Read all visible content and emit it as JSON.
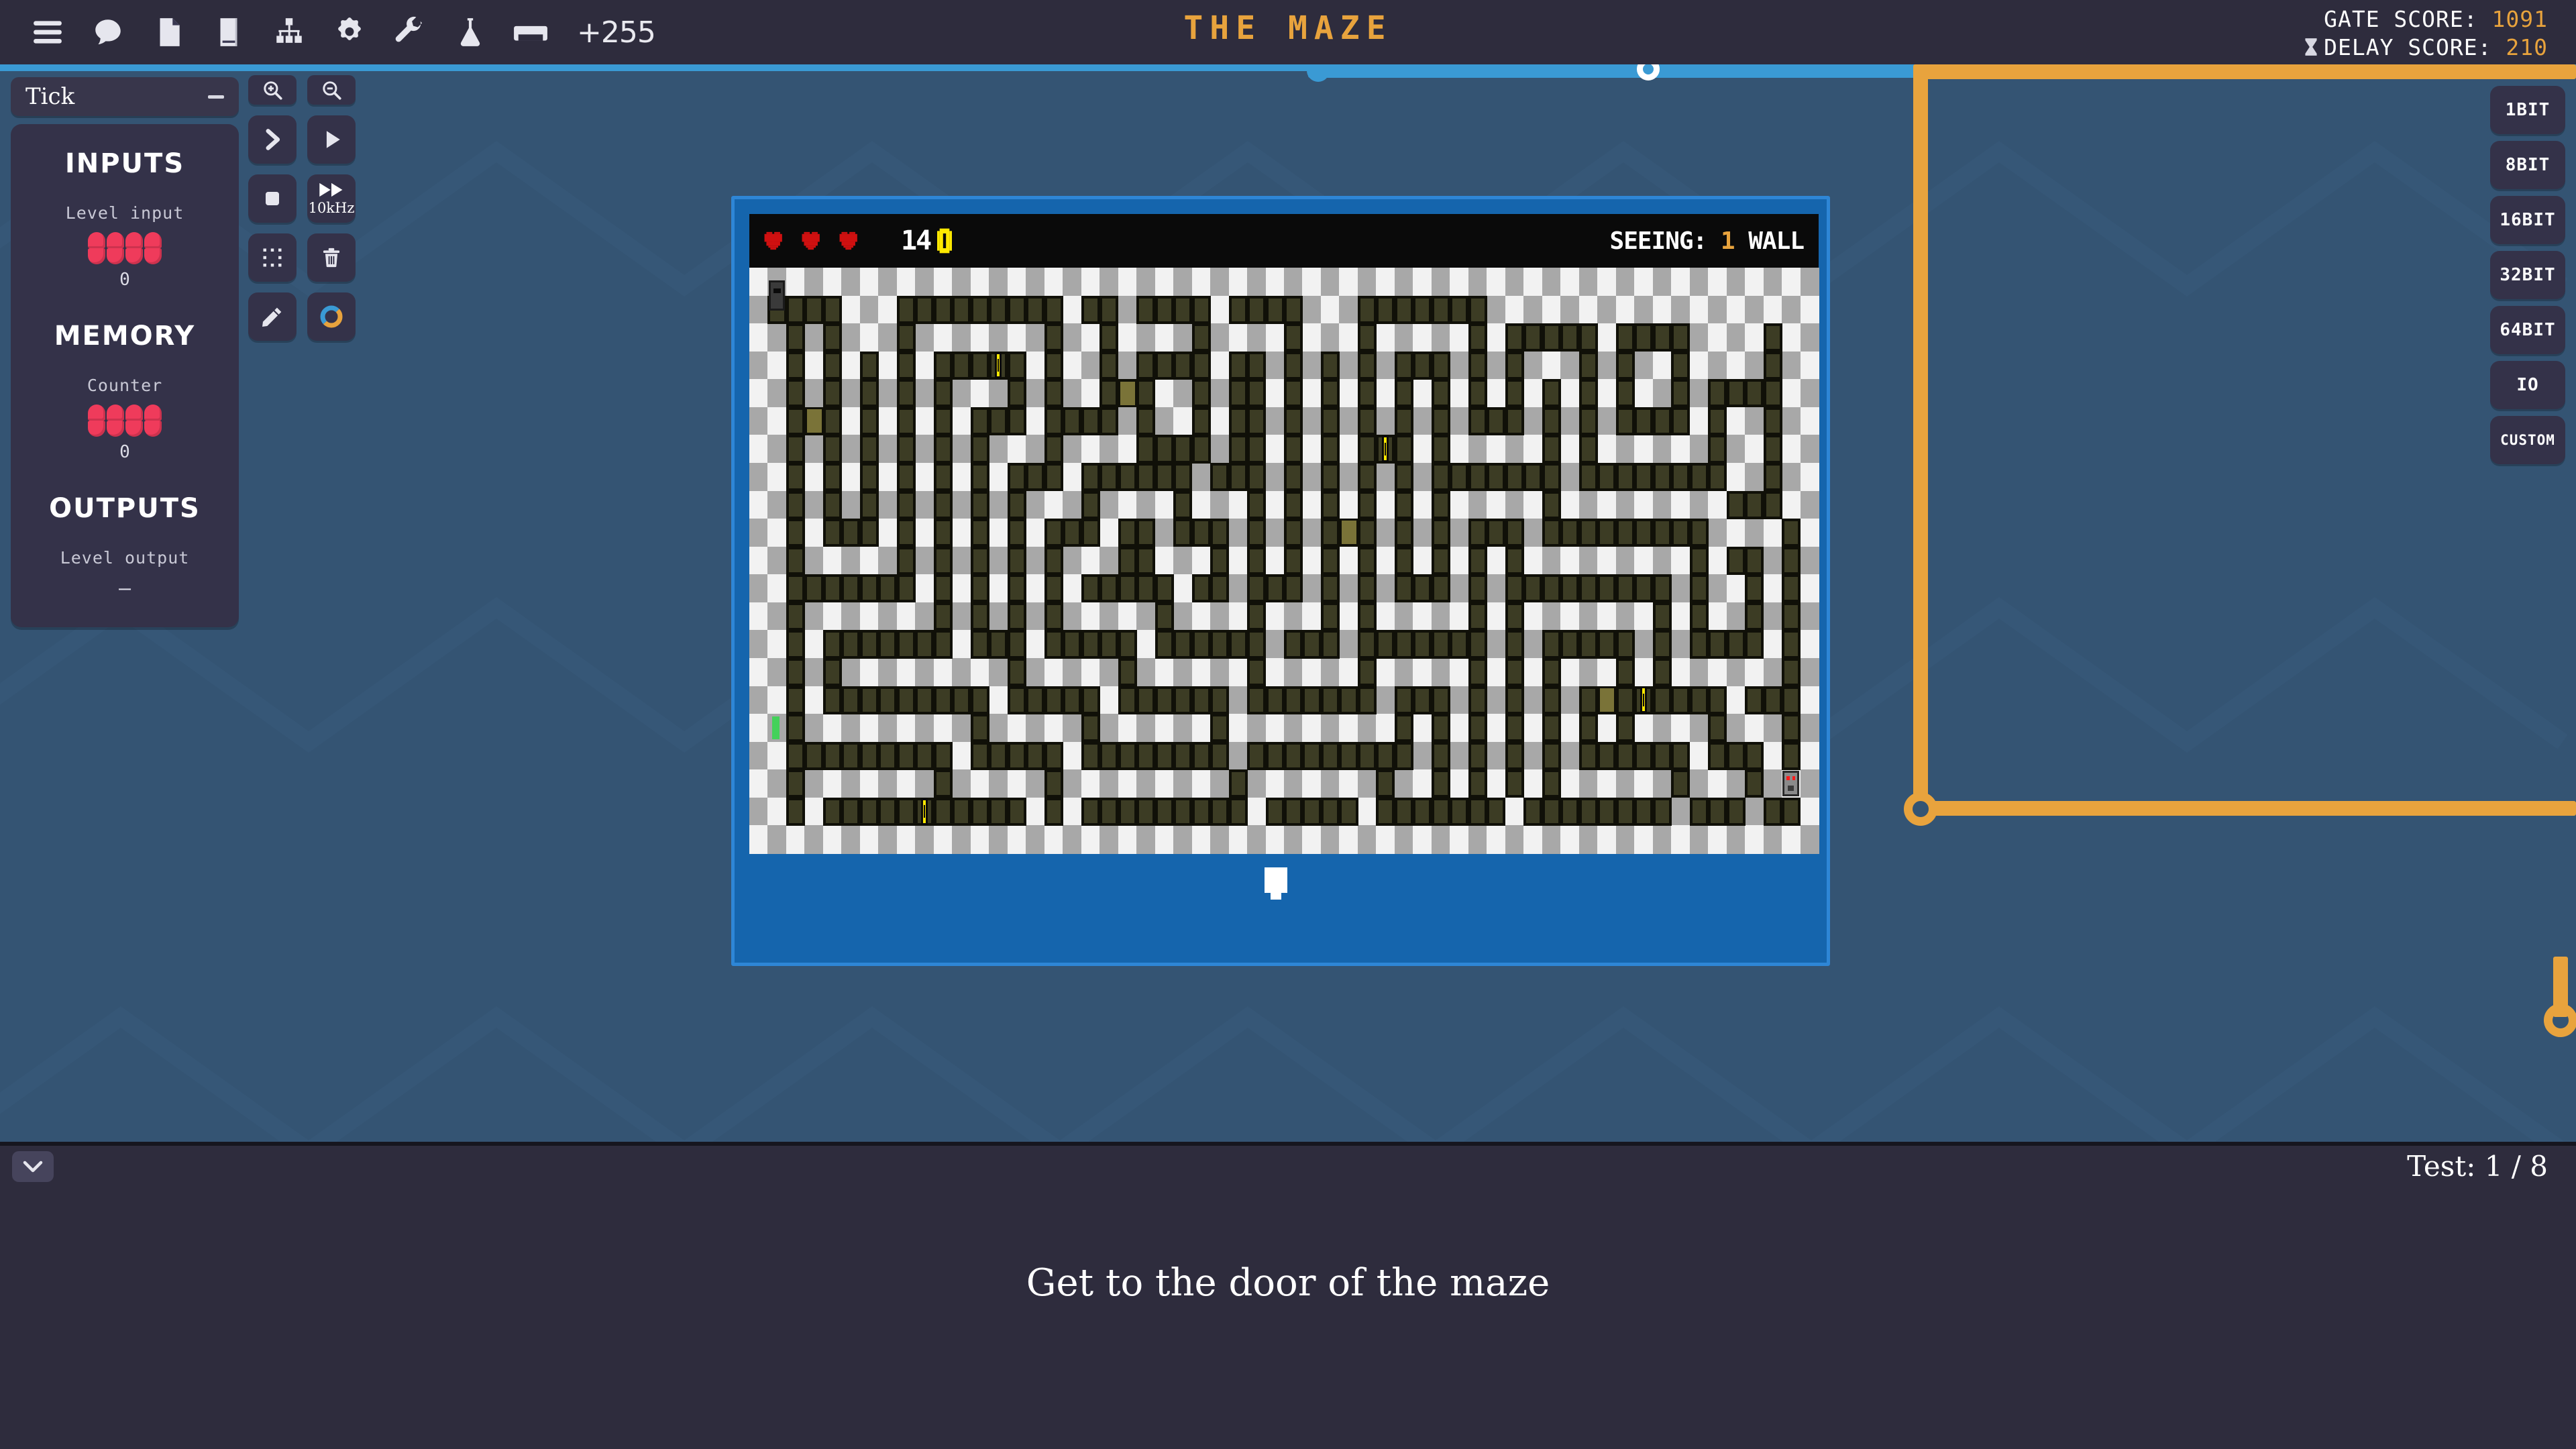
{
  "topbar": {
    "icons": [
      {
        "name": "menu-icon",
        "label": "Menu"
      },
      {
        "name": "chat-icon",
        "label": "Chat"
      },
      {
        "name": "file-icon",
        "label": "File"
      },
      {
        "name": "book-icon",
        "label": "Book"
      },
      {
        "name": "hierarchy-icon",
        "label": "Hierarchy"
      },
      {
        "name": "gear-icon",
        "label": "Settings"
      },
      {
        "name": "wrench-icon",
        "label": "Tools"
      },
      {
        "name": "flask-icon",
        "label": "Experiments"
      },
      {
        "name": "inbox-icon",
        "label": "Inbox"
      }
    ],
    "inbox_count": "+255",
    "title": "THE MAZE",
    "gate_score_label": "GATE SCORE:",
    "gate_score_value": "1091",
    "delay_score_label": "DELAY SCORE:",
    "delay_score_value": "210",
    "accent_color": "#e8a33d"
  },
  "left_panel": {
    "tick_title": "Tick",
    "collapse_icon": "minus-icon",
    "sections": {
      "inputs_heading": "INPUTS",
      "level_input_label": "Level input",
      "level_input_value": "0",
      "memory_heading": "MEMORY",
      "counter_label": "Counter",
      "counter_value": "0",
      "outputs_heading": "OUTPUTS",
      "level_output_label": "Level output",
      "level_output_value": "–"
    }
  },
  "toolbar": {
    "buttons": [
      {
        "name": "zoom-in-button",
        "icon": "zoom-in-icon",
        "label": ""
      },
      {
        "name": "zoom-out-button",
        "icon": "zoom-out-icon",
        "label": ""
      },
      {
        "name": "step-button",
        "icon": "step-forward-icon",
        "label": ""
      },
      {
        "name": "play-button",
        "icon": "play-icon",
        "label": ""
      },
      {
        "name": "stop-button",
        "icon": "stop-icon",
        "label": ""
      },
      {
        "name": "fast-forward-button",
        "icon": "fast-forward-icon",
        "label": "10kHz"
      },
      {
        "name": "select-button",
        "icon": "marquee-select-icon",
        "label": ""
      },
      {
        "name": "delete-button",
        "icon": "trash-icon",
        "label": ""
      },
      {
        "name": "draw-button",
        "icon": "pencil-icon",
        "label": ""
      },
      {
        "name": "palette-button",
        "icon": "color-wheel-icon",
        "label": ""
      }
    ],
    "speed_label": "10kHz"
  },
  "palette": {
    "items": [
      {
        "name": "palette-1bit",
        "label": "1BIT"
      },
      {
        "name": "palette-8bit",
        "label": "8BIT"
      },
      {
        "name": "palette-16bit",
        "label": "16BIT"
      },
      {
        "name": "palette-32bit",
        "label": "32BIT"
      },
      {
        "name": "palette-64bit",
        "label": "64BIT"
      },
      {
        "name": "palette-io",
        "label": "IO"
      },
      {
        "name": "palette-custom",
        "label": "CUSTOM"
      }
    ]
  },
  "game": {
    "hearts": 3,
    "coin_count": "14",
    "seeing_label": "SEEING:",
    "seeing_count": "1",
    "seeing_unit": "WALL",
    "coin_color": "#ffe900",
    "wall_color": "#3c3c24",
    "floor_color": "#f2f2f2"
  },
  "bottom": {
    "collapse_icon": "chevron-down-icon",
    "test_label": "Test: 1 / 8",
    "objective": "Get to the door of the maze"
  },
  "wires": {
    "blue_color": "#3a9ad4",
    "orange_color": "#e8a33d"
  }
}
